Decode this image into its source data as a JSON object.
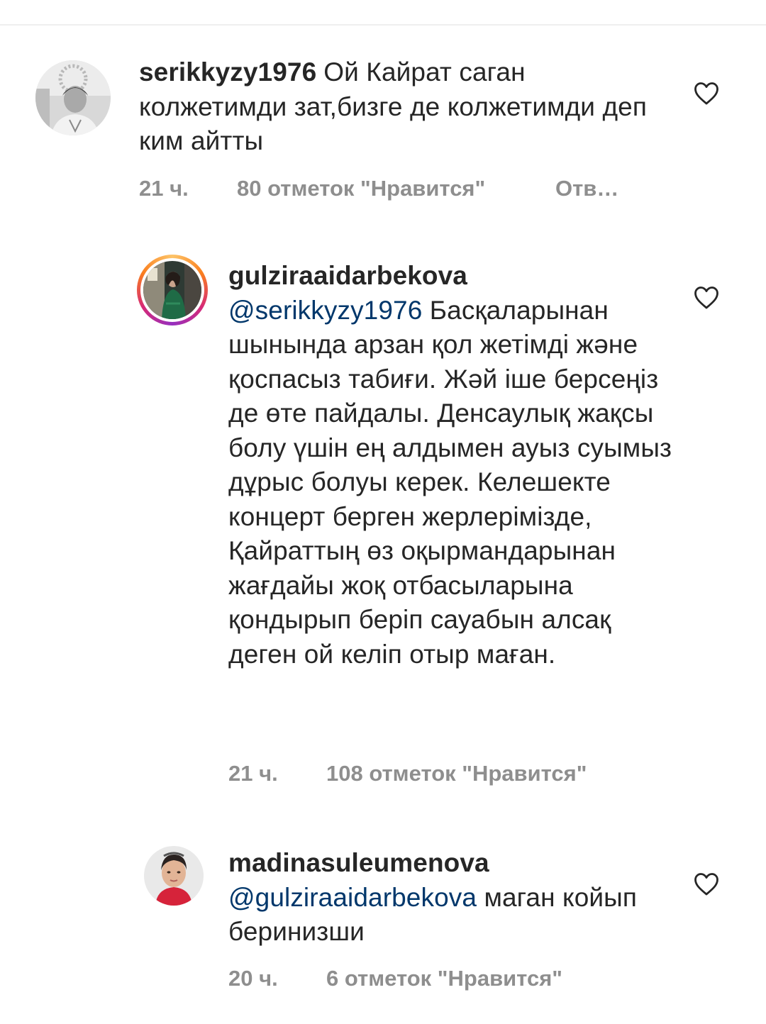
{
  "comments": [
    {
      "username": "serikkyzy1976",
      "text": "Ой Кайрат саган колжетимди зат,бизге де колжетимди деп ким айтты",
      "time": "21 ч.",
      "likes": "80 отметок \"Нравится\"",
      "reply": "Отв…"
    },
    {
      "username": "gulziraaidarbekova",
      "mention": "@serikkyzy1976",
      "text": "Басқаларынан шынында арзан қол жетімді және қоспасыз табиғи. Жәй іше берсеңіз де өте пайдалы. Денсаулық жақсы болу үшін ең алдымен ауыз суымыз дұрыс болуы керек. Келешекте концерт берген жерлерімізде, Қайраттың өз оқырмандарынан жағдайы жоқ отбасыларына қондырып беріп сауабын алсақ деген ой келіп отыр маған.",
      "time": "21 ч.",
      "likes": "108 отметок \"Нравится\""
    },
    {
      "username": "madinasuleumenova",
      "mention": "@gulziraaidarbekova",
      "text": "маган койып беринизши",
      "time": "20 ч.",
      "likes": "6 отметок \"Нравится\""
    }
  ],
  "icons": {
    "like": "heart-outline-icon",
    "story_ring": "story-ring"
  },
  "colors": {
    "mention": "#00376b",
    "meta": "#8e8e8e",
    "text": "#262626"
  }
}
